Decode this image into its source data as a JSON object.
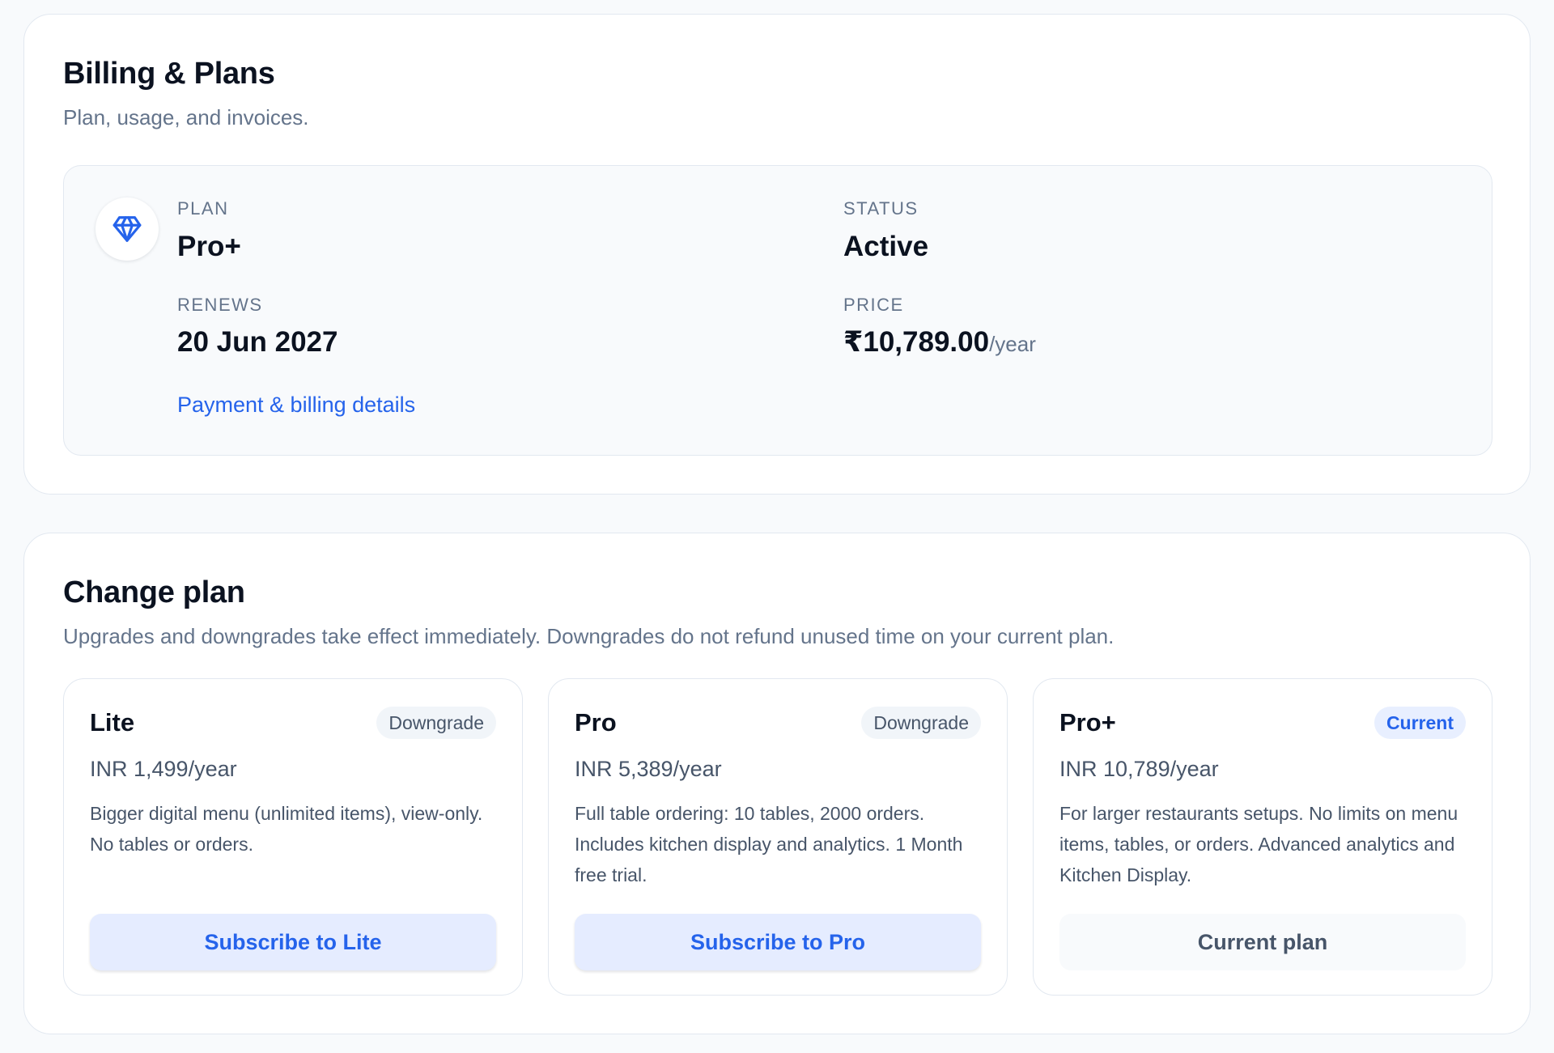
{
  "billing": {
    "title": "Billing & Plans",
    "subtitle": "Plan, usage, and invoices.",
    "summary": {
      "plan_icon": "diamond-icon",
      "plan_label": "PLAN",
      "plan_value": "Pro+",
      "status_label": "STATUS",
      "status_value": "Active",
      "renews_label": "RENEWS",
      "renews_value": "20 Jun 2027",
      "price_label": "PRICE",
      "price_value": "₹10,789.00",
      "price_unit": "/year",
      "billing_link": "Payment & billing details"
    }
  },
  "change_plan": {
    "title": "Change plan",
    "subtitle": "Upgrades and downgrades take effect immediately. Downgrades do not refund unused time on your current plan.",
    "plans": [
      {
        "name": "Lite",
        "badge": "Downgrade",
        "price": "INR 1,499/year",
        "description": "Bigger digital menu (unlimited items), view-only. No tables or orders.",
        "button": "Subscribe to Lite"
      },
      {
        "name": "Pro",
        "badge": "Downgrade",
        "price": "INR 5,389/year",
        "description": "Full table ordering: 10 tables, 2000 orders. Includes kitchen display and analytics. 1 Month free trial.",
        "button": "Subscribe to Pro"
      },
      {
        "name": "Pro+",
        "badge": "Current",
        "price": "INR 10,789/year",
        "description": "For larger restaurants setups. No limits on menu items, tables, or orders. Advanced analytics and Kitchen Display.",
        "button": "Current plan"
      }
    ]
  },
  "colors": {
    "accent": "#2563eb",
    "text": "#0b1220",
    "muted": "#64748b",
    "border": "#e2e8f0",
    "badge_bg": "#f1f5f9",
    "current_badge_bg": "#e8efff"
  }
}
